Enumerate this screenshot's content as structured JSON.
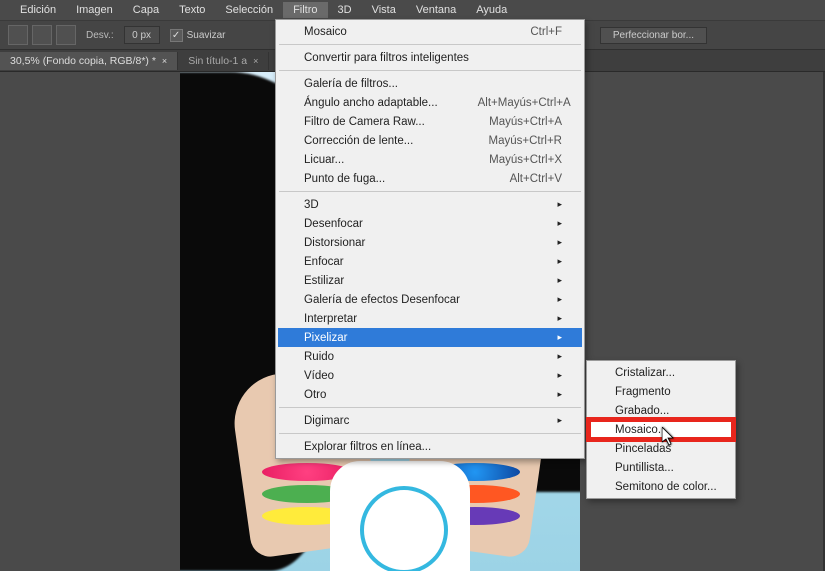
{
  "menubar": {
    "items": [
      "Edición",
      "Imagen",
      "Capa",
      "Texto",
      "Selección",
      "Filtro",
      "3D",
      "Vista",
      "Ventana",
      "Ayuda"
    ],
    "active_index": 5
  },
  "toolbar": {
    "desv_label": "Desv.:",
    "desv_value": "0 px",
    "suavizar_label": "Suavizar",
    "button_right": "Perfeccionar bor..."
  },
  "tabs": [
    {
      "label": "30,5% (Fondo copia, RGB/8*) *",
      "active": true
    },
    {
      "label": "Sin título-1 a",
      "active": false
    }
  ],
  "filter_menu": {
    "top": [
      {
        "label": "Mosaico",
        "shortcut": "Ctrl+F"
      }
    ],
    "convert": "Convertir para filtros inteligentes",
    "group1": [
      {
        "label": "Galería de filtros..."
      },
      {
        "label": "Ángulo ancho adaptable...",
        "shortcut": "Alt+Mayús+Ctrl+A"
      },
      {
        "label": "Filtro de Camera Raw...",
        "shortcut": "Mayús+Ctrl+A"
      },
      {
        "label": "Corrección de lente...",
        "shortcut": "Mayús+Ctrl+R"
      },
      {
        "label": "Licuar...",
        "shortcut": "Mayús+Ctrl+X"
      },
      {
        "label": "Punto de fuga...",
        "shortcut": "Alt+Ctrl+V"
      }
    ],
    "submenus": [
      "3D",
      "Desenfocar",
      "Distorsionar",
      "Enfocar",
      "Estilizar",
      "Galería de efectos Desenfocar",
      "Interpretar",
      "Pixelizar",
      "Ruido",
      "Vídeo",
      "Otro"
    ],
    "highlighted_index": 7,
    "digimarc": "Digimarc",
    "explore": "Explorar filtros en línea..."
  },
  "pixelize_submenu": {
    "items": [
      "Cristalizar...",
      "Fragmento",
      "Grabado...",
      "Mosaico...",
      "Pinceladas",
      "Puntillista...",
      "Semitono de color..."
    ],
    "highlighted_index": 3
  }
}
